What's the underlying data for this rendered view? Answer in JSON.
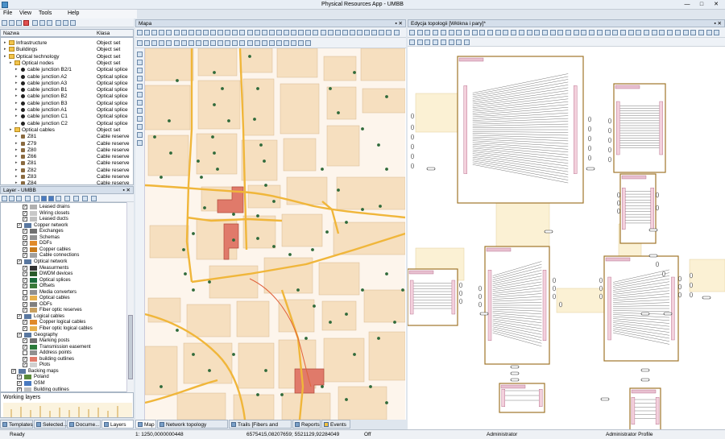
{
  "title": "Physical Resources App - UMBB",
  "window_buttons": [
    "—",
    "□",
    "✕"
  ],
  "menu": [
    "File",
    "View",
    "Tools",
    "Help"
  ],
  "tree_header": {
    "name": "Nazwa",
    "class": "Klasa"
  },
  "tree_rows": [
    {
      "label": "Infrastructure",
      "cls": "Object set",
      "kind": "folder",
      "level": 0
    },
    {
      "label": "Buildings",
      "cls": "Object set",
      "kind": "folder",
      "level": 0
    },
    {
      "label": "Optical technology",
      "cls": "Object set",
      "kind": "folder",
      "level": 0
    },
    {
      "label": "Optical nodes",
      "cls": "Object set",
      "kind": "folder",
      "level": 1
    },
    {
      "label": "cable junction B2/1",
      "cls": "Optical splice",
      "kind": "dot",
      "level": 2
    },
    {
      "label": "cable junction A2",
      "cls": "Optical splice",
      "kind": "dot",
      "level": 2
    },
    {
      "label": "cable junction A3",
      "cls": "Optical splice",
      "kind": "dot",
      "level": 2
    },
    {
      "label": "cable junction B1",
      "cls": "Optical splice",
      "kind": "dot",
      "level": 2
    },
    {
      "label": "cable junction B2",
      "cls": "Optical splice",
      "kind": "dot",
      "level": 2
    },
    {
      "label": "cable junction B3",
      "cls": "Optical splice",
      "kind": "dot",
      "level": 2
    },
    {
      "label": "cable junction A1",
      "cls": "Optical splice",
      "kind": "dot",
      "level": 2
    },
    {
      "label": "cable junction C1",
      "cls": "Optical splice",
      "kind": "dot",
      "level": 2
    },
    {
      "label": "cable junction C2",
      "cls": "Optical splice",
      "kind": "dot",
      "level": 2
    },
    {
      "label": "Optical cables",
      "cls": "Object set",
      "kind": "folder",
      "level": 1
    },
    {
      "label": "Z81",
      "cls": "Cable reserve",
      "kind": "cable",
      "level": 2
    },
    {
      "label": "Z79",
      "cls": "Cable reserve",
      "kind": "cable",
      "level": 2
    },
    {
      "label": "Z80",
      "cls": "Cable reserve",
      "kind": "cable",
      "level": 2
    },
    {
      "label": "Z66",
      "cls": "Cable reserve",
      "kind": "cable",
      "level": 2
    },
    {
      "label": "Z81",
      "cls": "Cable reserve",
      "kind": "cable",
      "level": 2
    },
    {
      "label": "Z82",
      "cls": "Cable reserve",
      "kind": "cable",
      "level": 2
    },
    {
      "label": "Z83",
      "cls": "Cable reserve",
      "kind": "cable",
      "level": 2
    },
    {
      "label": "Z84",
      "cls": "Cable reserve",
      "kind": "cable",
      "level": 2
    }
  ],
  "layer_panel_title": "Layer - UMBB",
  "layer_rows": [
    {
      "label": "Leased drains",
      "level": 3,
      "checked": true,
      "sw": "#b0b0b0"
    },
    {
      "label": "Wiring closets",
      "level": 3,
      "checked": true,
      "sw": "#c8c8c8"
    },
    {
      "label": "Leased ducts",
      "level": 3,
      "checked": true,
      "sw": "#c0c0c0"
    },
    {
      "label": "Copper network",
      "level": 2,
      "checked": true,
      "sw": "#5a78a0"
    },
    {
      "label": "Exchanges",
      "level": 3,
      "checked": true,
      "sw": "#707070"
    },
    {
      "label": "Schemas",
      "level": 3,
      "checked": true,
      "sw": "#909090"
    },
    {
      "label": "DDFs",
      "level": 3,
      "checked": true,
      "sw": "#e08a2a"
    },
    {
      "label": "Copper cables",
      "level": 3,
      "checked": true,
      "sw": "#c87a1a"
    },
    {
      "label": "Cable connections",
      "level": 3,
      "checked": true,
      "sw": "#a0a0a0"
    },
    {
      "label": "Optical network",
      "level": 2,
      "checked": true,
      "sw": "#5a78a0"
    },
    {
      "label": "Measurments",
      "level": 3,
      "checked": true,
      "sw": "#333333"
    },
    {
      "label": "DWDM devices",
      "level": 3,
      "checked": true,
      "sw": "#2a5a2a"
    },
    {
      "label": "Optical splices",
      "level": 3,
      "checked": true,
      "sw": "#1a6a3a"
    },
    {
      "label": "Offsets",
      "level": 3,
      "checked": true,
      "sw": "#3a7a3a"
    },
    {
      "label": "Media converters",
      "level": 3,
      "checked": false,
      "sw": "#909090"
    },
    {
      "label": "Optical cables",
      "level": 3,
      "checked": true,
      "sw": "#e8b04a"
    },
    {
      "label": "ODFs",
      "level": 3,
      "checked": true,
      "sw": "#808080"
    },
    {
      "label": "Fiber optic reserves",
      "level": 3,
      "checked": true,
      "sw": "#c8a060"
    },
    {
      "label": "Logical cables",
      "level": 2,
      "checked": true,
      "sw": "#5a78a0"
    },
    {
      "label": "Copper logical cables",
      "level": 3,
      "checked": true,
      "sw": "#e08a2a"
    },
    {
      "label": "Fiber optic logical cables",
      "level": 3,
      "checked": true,
      "sw": "#e8b04a"
    },
    {
      "label": "Geography",
      "level": 2,
      "checked": true,
      "sw": "#5a78a0"
    },
    {
      "label": "Marking posts",
      "level": 3,
      "checked": true,
      "sw": "#707070"
    },
    {
      "label": "Transmission easement",
      "level": 3,
      "checked": true,
      "sw": "#2a7a3a"
    },
    {
      "label": "Address points",
      "level": 3,
      "checked": false,
      "sw": "#909090"
    },
    {
      "label": "building outlines",
      "level": 3,
      "checked": true,
      "sw": "#e07a6a"
    },
    {
      "label": "Plots",
      "level": 3,
      "checked": true,
      "sw": "#d0d0d0"
    },
    {
      "label": "Backing maps",
      "level": 1,
      "checked": true,
      "sw": "#5a78a0"
    },
    {
      "label": "Poland",
      "level": 2,
      "checked": true,
      "sw": "#5a8a3a"
    },
    {
      "label": "OSM",
      "level": 2,
      "checked": true,
      "sw": "#4a7ac0"
    },
    {
      "label": "Building outlines",
      "level": 2,
      "checked": true,
      "sw": "#c0c0c0"
    }
  ],
  "working_layers": "Working layers",
  "left_tabs": [
    "Templates",
    "Selected...",
    "Docume...",
    "Layers"
  ],
  "map_title": "Mapa",
  "topo_title": "Edycja topologii [Włókna i pary]*",
  "map_tabs": [
    "Map",
    "Network topology [Fibers]...",
    "Trails [Fibers and pairs]",
    "Reports",
    "Events"
  ],
  "status": {
    "ready": "Ready",
    "scale": "1: 1250,0000000448",
    "coords": "6575415,08207659; 5521129,92284049",
    "off": "Off",
    "user": "Administrator",
    "profile": "Administrator Profile"
  },
  "colors": {
    "road": "#f0b63a",
    "building": "#f6dfbf",
    "highlight": "#e07a6a",
    "splice": "#2f6a3a",
    "node_border": "#a0762a",
    "cable_band": "#fbf1d4"
  }
}
